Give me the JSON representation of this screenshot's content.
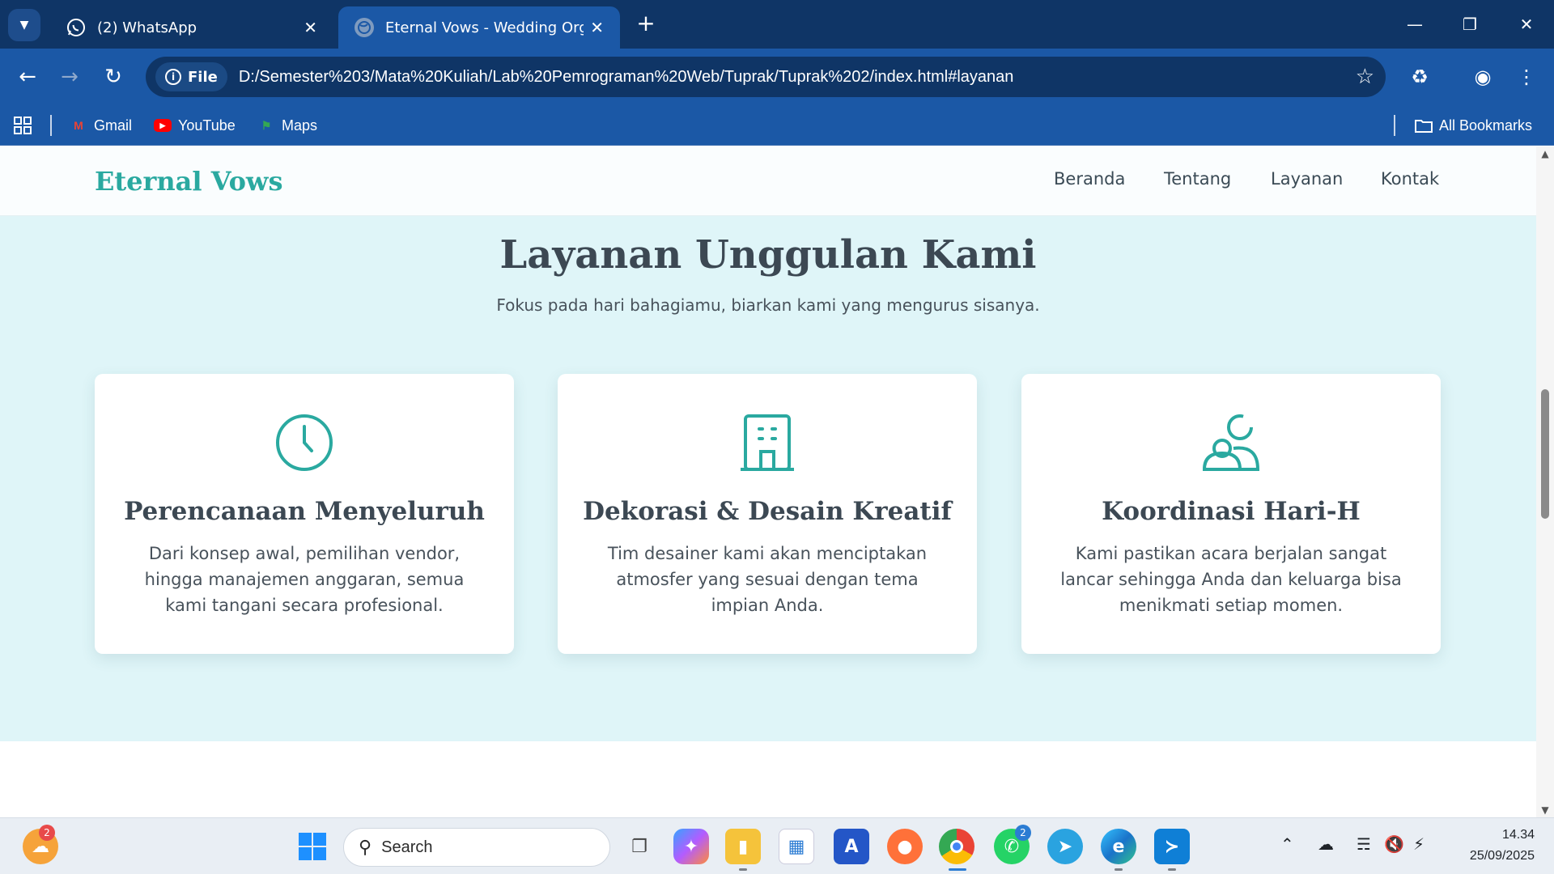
{
  "browser": {
    "tabs": [
      {
        "title": "(2) WhatsApp",
        "active": false
      },
      {
        "title": "Eternal Vows - Wedding Organi",
        "active": true
      }
    ],
    "url": "D:/Semester%203/Mata%20Kuliah/Lab%20Pemrograman%20Web/Tuprak/Tuprak%202/index.html#layanan",
    "site_chip": "File",
    "bookmarks": [
      "Gmail",
      "YouTube",
      "Maps"
    ],
    "all_bookmarks": "All Bookmarks"
  },
  "site": {
    "logo": "Eternal Vows",
    "nav": [
      "Beranda",
      "Tentang",
      "Layanan",
      "Kontak"
    ]
  },
  "services": {
    "title": "Layanan Unggulan Kami",
    "subtitle": "Fokus pada hari bahagiamu, biarkan kami yang mengurus sisanya.",
    "cards": [
      {
        "icon": "clock-icon",
        "title": "Perencanaan Menyeluruh",
        "text": "Dari konsep awal, pemilihan vendor, hingga manajemen anggaran, semua kami tangani secara profesional."
      },
      {
        "icon": "building-icon",
        "title": "Dekorasi & Desain Kreatif",
        "text": "Tim desainer kami akan menciptakan atmosfer yang sesuai dengan tema impian Anda."
      },
      {
        "icon": "users-icon",
        "title": "Koordinasi Hari-H",
        "text": "Kami pastikan acara berjalan sangat lancar sehingga Anda dan keluarga bisa menikmati setiap momen."
      }
    ]
  },
  "taskbar": {
    "search_placeholder": "Search",
    "weather_badge": "2",
    "whatsapp_badge": "2",
    "time": "14.34",
    "date": "25/09/2025"
  },
  "colors": {
    "accent": "#2aa9a0",
    "section_bg": "#dff5f8",
    "chrome_dark": "#0f3566",
    "chrome": "#1b58a6"
  }
}
